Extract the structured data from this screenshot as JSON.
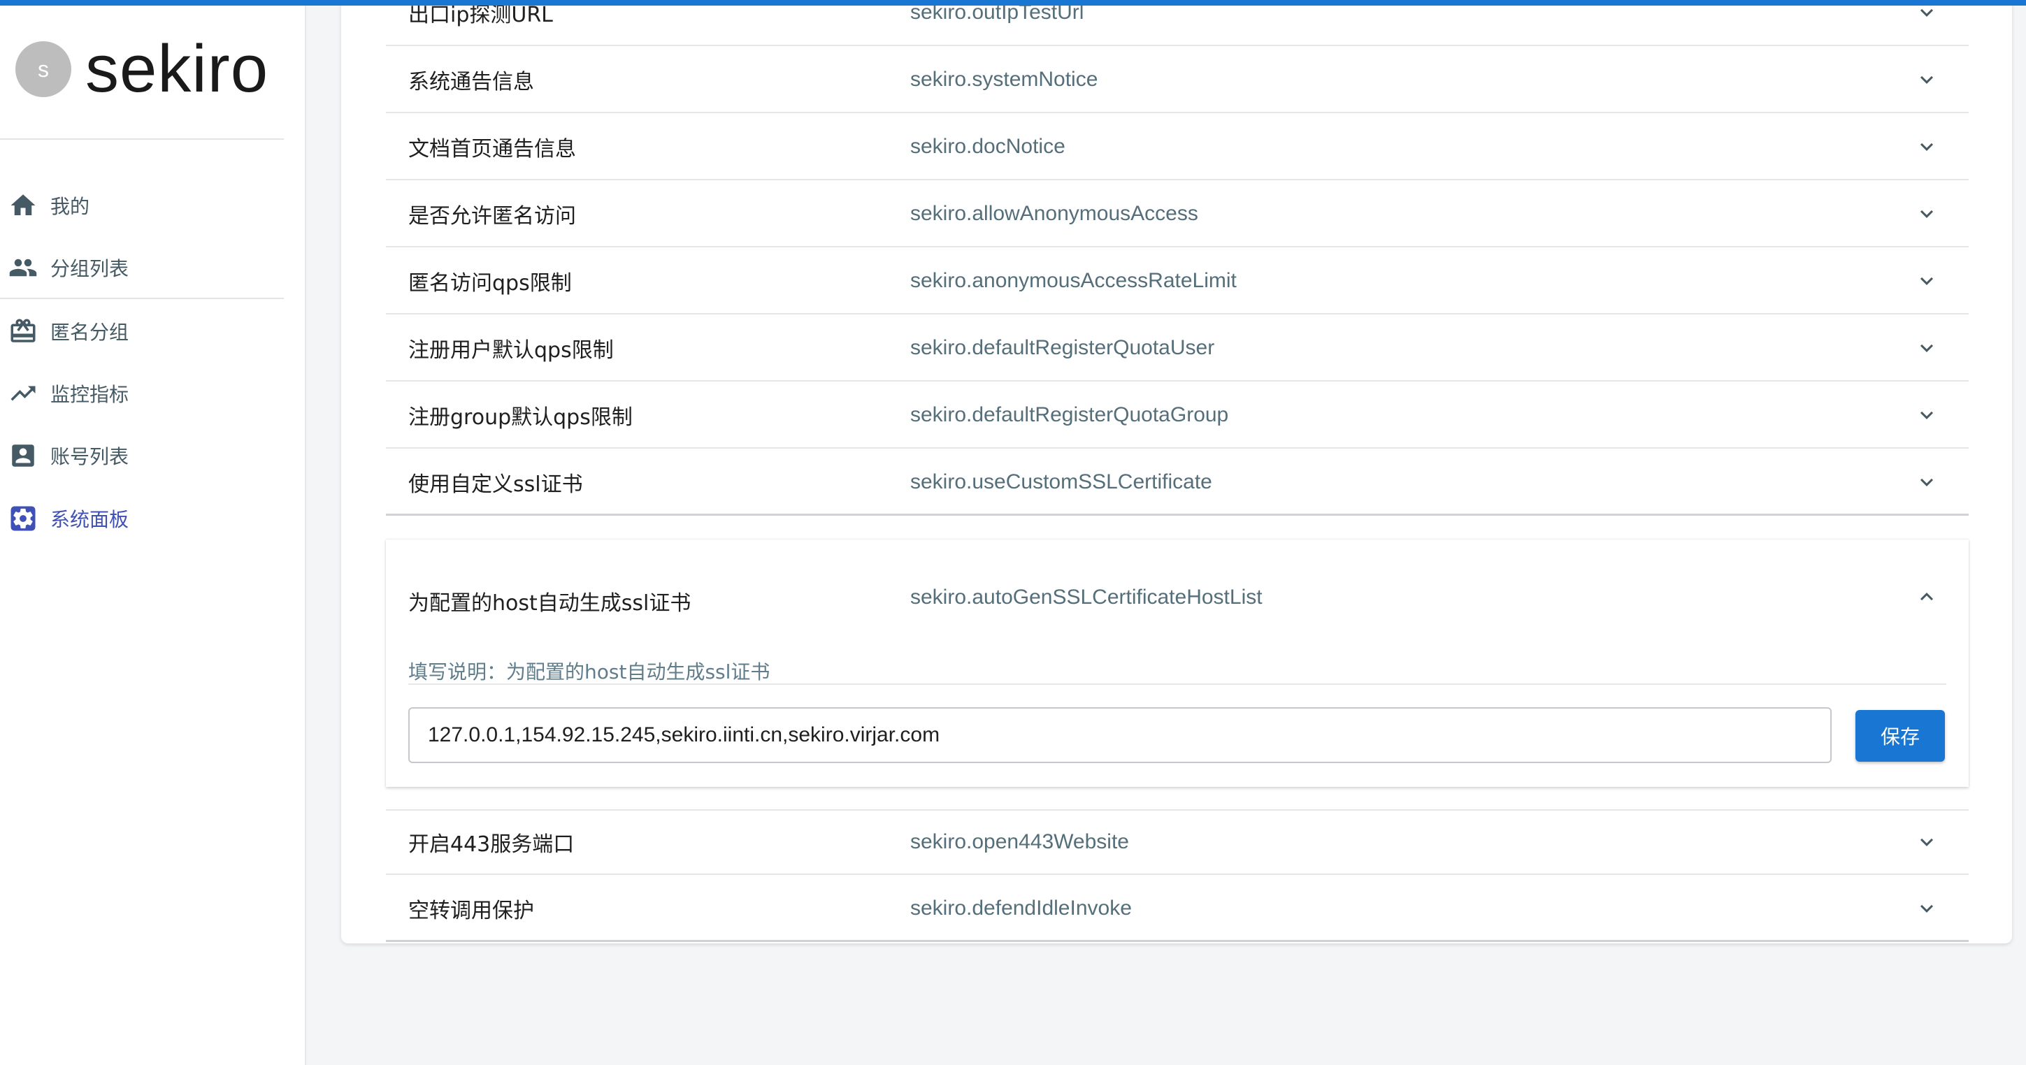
{
  "brand": {
    "avatar_letter": "s",
    "name": "sekiro"
  },
  "theme": {
    "accent": "#1976d2",
    "active_nav": "#3f51b5",
    "nav_icon": "#455a64"
  },
  "sidebar": {
    "items": [
      {
        "label": "我的",
        "icon": "home-icon",
        "active": false
      },
      {
        "label": "分组列表",
        "icon": "group-icon",
        "active": false
      },
      {
        "label": "匿名分组",
        "icon": "card-giftcard-icon",
        "active": false
      },
      {
        "label": "监控指标",
        "icon": "trending-up-icon",
        "active": false
      },
      {
        "label": "账号列表",
        "icon": "account-box-icon",
        "active": false
      },
      {
        "label": "系统面板",
        "icon": "settings-gear-icon",
        "active": true
      }
    ]
  },
  "settings": {
    "rows_before": [
      {
        "title": "出口ip探测URL",
        "key": "sekiro.outIpTestUrl"
      },
      {
        "title": "系统通告信息",
        "key": "sekiro.systemNotice"
      },
      {
        "title": "文档首页通告信息",
        "key": "sekiro.docNotice"
      },
      {
        "title": "是否允许匿名访问",
        "key": "sekiro.allowAnonymousAccess"
      },
      {
        "title": "匿名访问qps限制",
        "key": "sekiro.anonymousAccessRateLimit"
      },
      {
        "title": "注册用户默认qps限制",
        "key": "sekiro.defaultRegisterQuotaUser"
      },
      {
        "title": "注册group默认qps限制",
        "key": "sekiro.defaultRegisterQuotaGroup"
      },
      {
        "title": "使用自定义ssl证书",
        "key": "sekiro.useCustomSSLCertificate"
      }
    ],
    "expanded": {
      "title": "为配置的host自动生成ssl证书",
      "key": "sekiro.autoGenSSLCertificateHostList",
      "help": "填写说明：为配置的host自动生成ssl证书",
      "value": "127.0.0.1,154.92.15.245,sekiro.iinti.cn,sekiro.virjar.com",
      "save_label": "保存"
    },
    "rows_after": [
      {
        "title": "开启443服务端口",
        "key": "sekiro.open443Website"
      },
      {
        "title": "空转调用保护",
        "key": "sekiro.defendIdleInvoke"
      }
    ]
  }
}
